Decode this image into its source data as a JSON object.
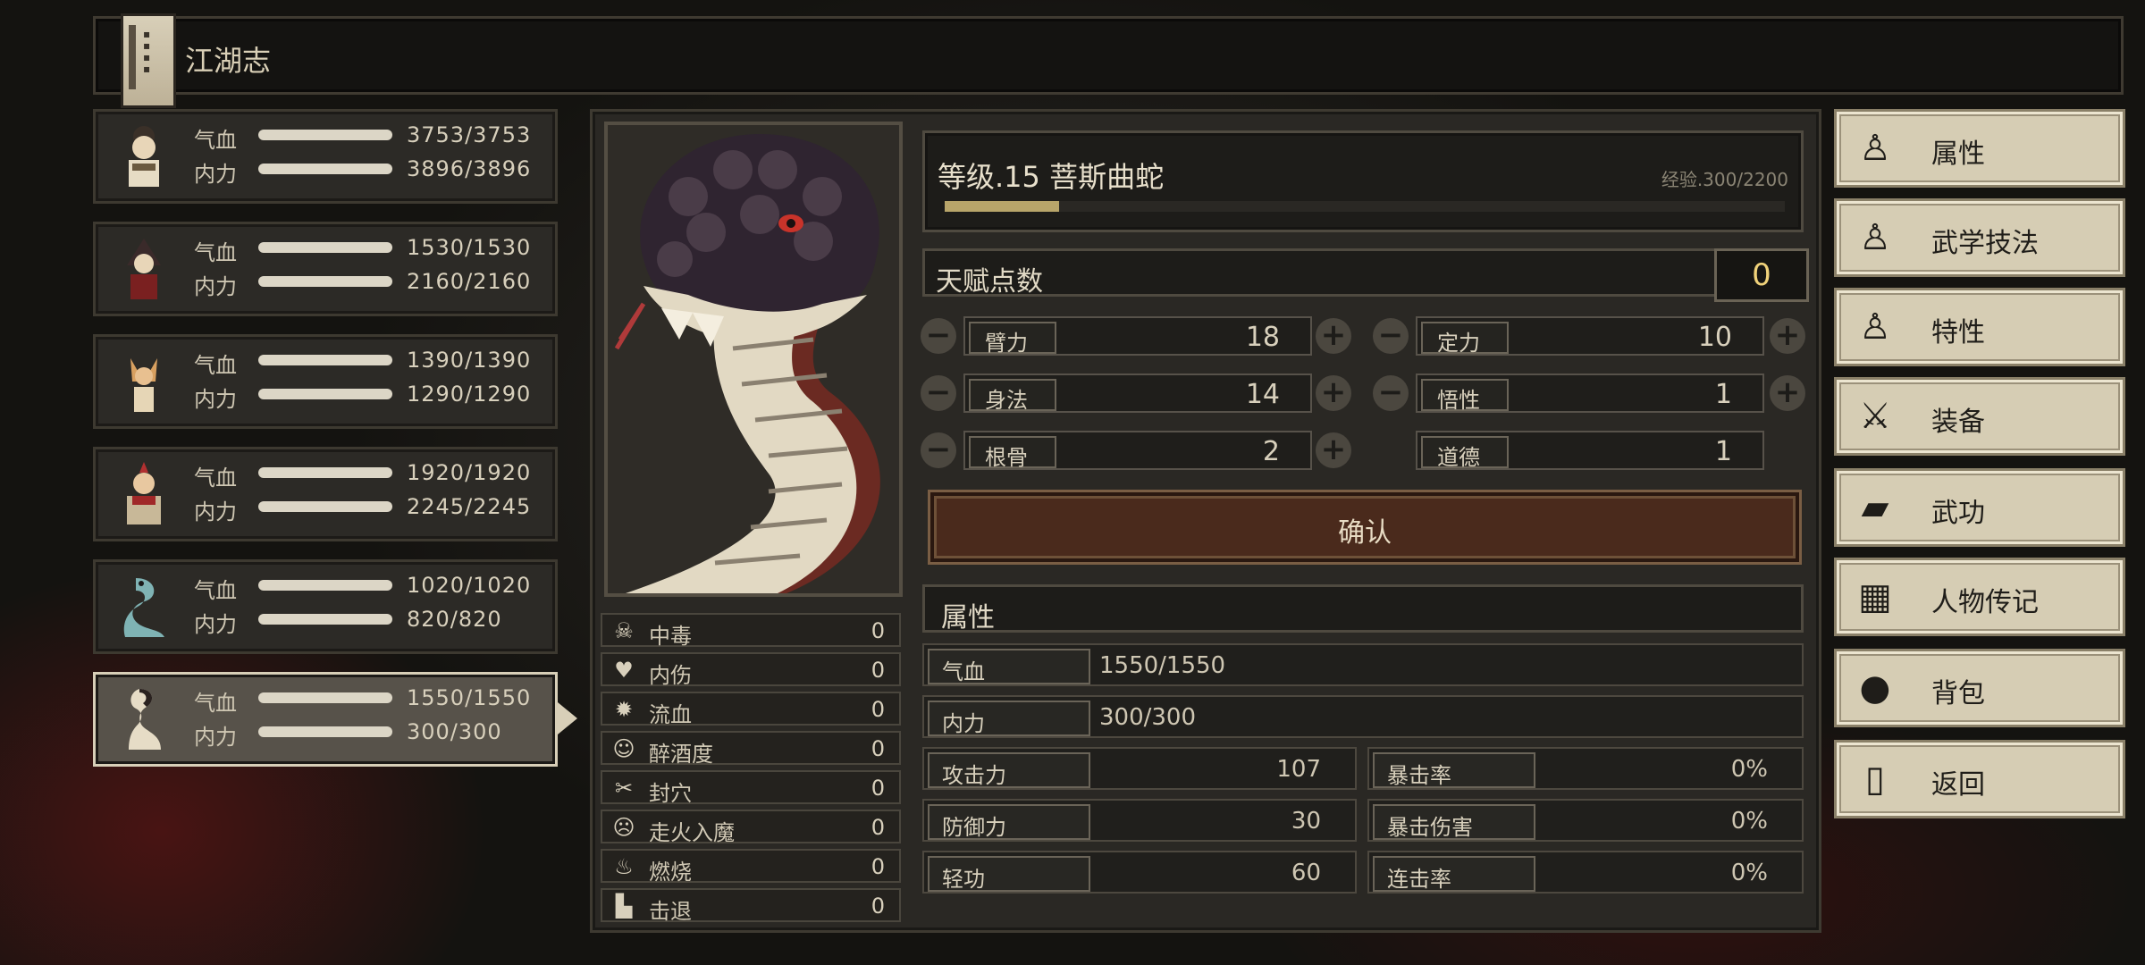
{
  "window": {
    "title": "江湖志"
  },
  "party": [
    {
      "name": "character-1",
      "hp_label": "气血",
      "hp": "3753/3753",
      "mp_label": "内力",
      "mp": "3896/3896"
    },
    {
      "name": "character-2",
      "hp_label": "气血",
      "hp": "1530/1530",
      "mp_label": "内力",
      "mp": "2160/2160"
    },
    {
      "name": "character-3",
      "hp_label": "气血",
      "hp": "1390/1390",
      "mp_label": "内力",
      "mp": "1290/1290"
    },
    {
      "name": "character-4",
      "hp_label": "气血",
      "hp": "1920/1920",
      "mp_label": "内力",
      "mp": "2245/2245"
    },
    {
      "name": "character-5",
      "hp_label": "气血",
      "hp": "1020/1020",
      "mp_label": "内力",
      "mp": "820/820"
    },
    {
      "name": "character-6",
      "hp_label": "气血",
      "hp": "1550/1550",
      "mp_label": "内力",
      "mp": "300/300"
    }
  ],
  "statuses": [
    {
      "icon": "skull-icon",
      "label": "中毒",
      "value": "0"
    },
    {
      "icon": "broken-heart-icon",
      "label": "内伤",
      "value": "0"
    },
    {
      "icon": "blood-drop-icon",
      "label": "流血",
      "value": "0"
    },
    {
      "icon": "dizzy-face-icon",
      "label": "醉酒度",
      "value": "0"
    },
    {
      "icon": "needle-icon",
      "label": "封穴",
      "value": "0"
    },
    {
      "icon": "demon-face-icon",
      "label": "走火入魔",
      "value": "0"
    },
    {
      "icon": "flame-icon",
      "label": "燃烧",
      "value": "0"
    },
    {
      "icon": "boot-icon",
      "label": "击退",
      "value": "0"
    }
  ],
  "character": {
    "level_text": "等级.15  菩斯曲蛇",
    "exp_text": "经验.300/2200",
    "exp_fraction": 0.136
  },
  "talent": {
    "label": "天赋点数",
    "points": "0"
  },
  "stats": {
    "strength": {
      "label": "臂力",
      "value": "18"
    },
    "focus": {
      "label": "定力",
      "value": "10"
    },
    "agility": {
      "label": "身法",
      "value": "14"
    },
    "insight": {
      "label": "悟性",
      "value": "1"
    },
    "constitution": {
      "label": "根骨",
      "value": "2"
    },
    "morality": {
      "label": "道德",
      "value": "1"
    }
  },
  "confirm_label": "确认",
  "attributes": {
    "header": "属性",
    "hp": {
      "label": "气血",
      "value": "1550/1550"
    },
    "mp": {
      "label": "内力",
      "value": "300/300"
    },
    "attack": {
      "label": "攻击力",
      "value": "107"
    },
    "crit_rate": {
      "label": "暴击率",
      "value": "0%"
    },
    "defense": {
      "label": "防御力",
      "value": "30"
    },
    "crit_damage": {
      "label": "暴击伤害",
      "value": "0%"
    },
    "qinggong": {
      "label": "轻功",
      "value": "60"
    },
    "combo_rate": {
      "label": "连击率",
      "value": "0%"
    }
  },
  "menu": [
    {
      "icon": "figure-icon",
      "label": "属性"
    },
    {
      "icon": "figure-sparkle-icon",
      "label": "武学技法"
    },
    {
      "icon": "figure-heart-icon",
      "label": "特性"
    },
    {
      "icon": "sword-icon",
      "label": "装备"
    },
    {
      "icon": "manual-book-icon",
      "label": "武功"
    },
    {
      "icon": "scroll-icon",
      "label": "人物传记"
    },
    {
      "icon": "bag-icon",
      "label": "背包"
    },
    {
      "icon": "door-icon",
      "label": "返回"
    }
  ]
}
